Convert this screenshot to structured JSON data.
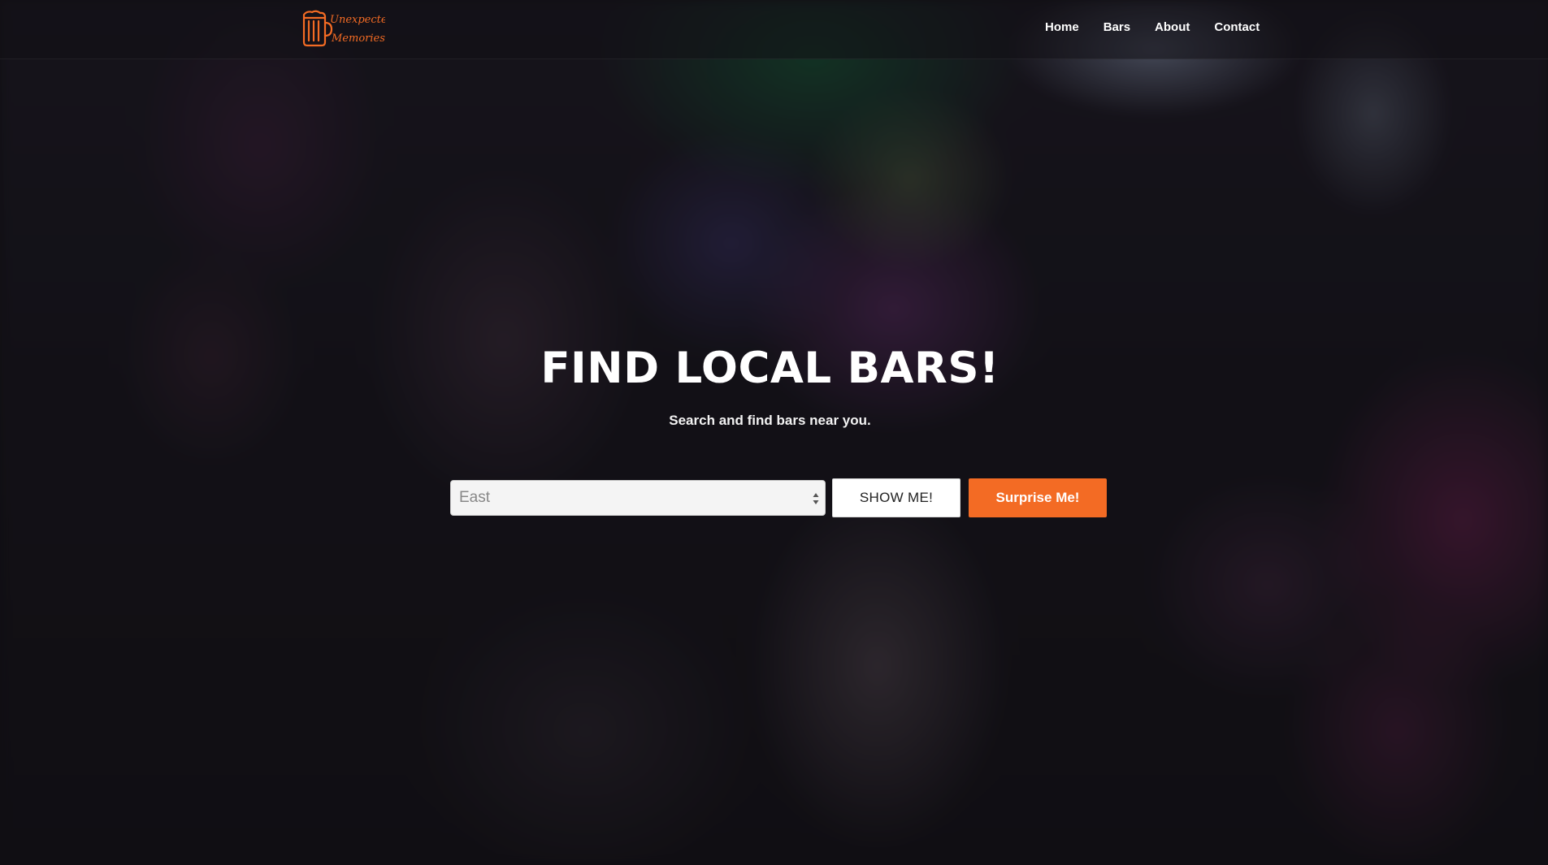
{
  "brand": {
    "logo_text_line1": "Unexpected",
    "logo_text_line2": "Memories",
    "logo_color": "#f36b24"
  },
  "nav": {
    "items": [
      {
        "label": "Home"
      },
      {
        "label": "Bars"
      },
      {
        "label": "About"
      },
      {
        "label": "Contact"
      }
    ]
  },
  "hero": {
    "title": "FIND LOCAL BARS!",
    "subtitle": "Search and find bars near you."
  },
  "search": {
    "selected_area": "East",
    "show_button": "SHOW ME!",
    "surprise_button": "Surprise Me!"
  },
  "colors": {
    "accent": "#f36b24",
    "text": "#ffffff"
  },
  "icons": {
    "logo": "beer-mug-icon",
    "select_arrows": "up-down-arrows-icon"
  }
}
